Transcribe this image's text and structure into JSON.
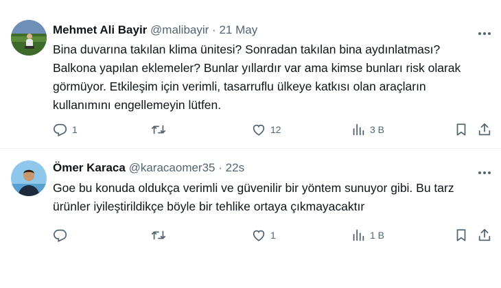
{
  "tweets": [
    {
      "name": "Mehmet Ali Bayir",
      "handle": "@malibayir",
      "separator": "·",
      "time": "21 May",
      "text": "Bina duvarına takılan klima ünitesi? Sonradan takılan bina aydınlatması?\nBalkona yapılan eklemeler? Bunlar yıllardır var ama kimse bunları risk olarak\ngörmüyor. Etkileşim için verimli, tasarruflu ülkeye katkısı olan araçların\nkullanımını engellemeyin lütfen.",
      "replies": "1",
      "retweets": "",
      "likes": "12",
      "views": "3 B"
    },
    {
      "name": "Ömer Karaca",
      "handle": "@karacaomer35",
      "separator": "·",
      "time": "22s",
      "text": "Goe bu konuda oldukça verimli ve güvenilir bir yöntem sunuyor gibi. Bu tarz\nürünler iyileştirildikçe böyle bir tehlike ortaya çıkmayacaktır",
      "replies": "",
      "retweets": "",
      "likes": "1",
      "views": "1 B"
    }
  ],
  "icons": {
    "reply": "reply-icon",
    "retweet": "retweet-icon",
    "like": "heart-icon",
    "views": "views-icon",
    "bookmark": "bookmark-icon",
    "share": "share-icon",
    "more": "more-icon"
  },
  "colors": {
    "text": "#0f1419",
    "secondary": "#536471",
    "divider": "#eff3f4"
  }
}
